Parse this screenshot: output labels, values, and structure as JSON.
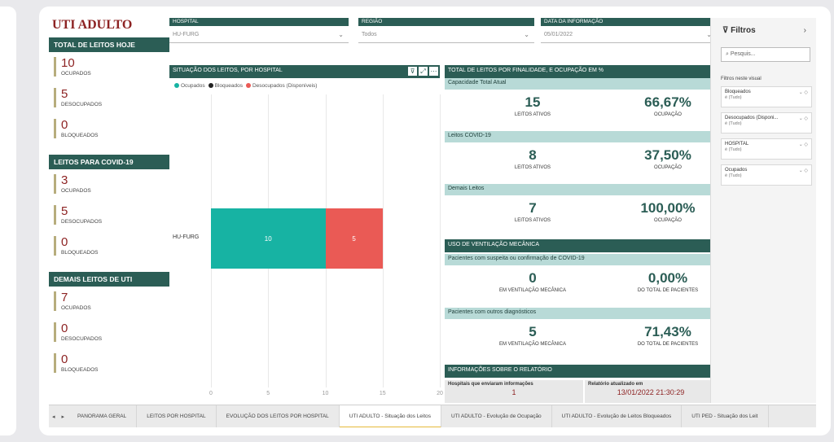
{
  "report": {
    "title": "UTI ADULTO",
    "sections": [
      {
        "header": "TOTAL DE LEITOS HOJE",
        "kpis": [
          {
            "value": "10",
            "label": "OCUPADOS"
          },
          {
            "value": "5",
            "label": "DESOCUPADOS"
          },
          {
            "value": "0",
            "label": "BLOQUEADOS"
          }
        ]
      },
      {
        "header": "LEITOS PARA COVID-19",
        "kpis": [
          {
            "value": "3",
            "label": "OCUPADOS"
          },
          {
            "value": "5",
            "label": "DESOCUPADOS"
          },
          {
            "value": "0",
            "label": "BLOQUEADOS"
          }
        ]
      },
      {
        "header": "DEMAIS LEITOS DE UTI",
        "kpis": [
          {
            "value": "7",
            "label": "OCUPADOS"
          },
          {
            "value": "0",
            "label": "DESOCUPADOS"
          },
          {
            "value": "0",
            "label": "BLOQUEADOS"
          }
        ]
      }
    ],
    "slicers": [
      {
        "label": "HOSPITAL",
        "value": "HU-FURG"
      },
      {
        "label": "REGIÃO",
        "value": "Todos"
      },
      {
        "label": "DATA DA INFORMAÇÃO",
        "value": "05/01/2022"
      }
    ],
    "chart_title": "SITUAÇÃO DOS LEITOS, POR HOSPITAL",
    "chart_icons": [
      "filter-icon",
      "focus-mode-icon",
      "more-options-icon"
    ],
    "right": {
      "header": "TOTAL DE LEITOS POR FINALIDADE, E OCUPAÇÃO EM %",
      "groups": [
        {
          "sub": "Capacidade Total Atual",
          "a_value": "15",
          "a_label": "LEITOS ATIVOS",
          "b_value": "66,67%",
          "b_label": "OCUPAÇÃO"
        },
        {
          "sub": "Leitos COVID-19",
          "a_value": "8",
          "a_label": "LEITOS ATIVOS",
          "b_value": "37,50%",
          "b_label": "OCUPAÇÃO"
        },
        {
          "sub": "Demais Leitos",
          "a_value": "7",
          "a_label": "LEITOS ATIVOS",
          "b_value": "100,00%",
          "b_label": "OCUPAÇÃO"
        }
      ],
      "vent_header": "USO DE VENTILAÇÃO MECÂNICA",
      "vent_groups": [
        {
          "sub": "Pacientes com suspeita ou confirmação de COVID-19",
          "a_value": "0",
          "a_label": "EM VENTILAÇÃO MECÂNICA",
          "b_value": "0,00%",
          "b_label": "DO TOTAL DE PACIENTES"
        },
        {
          "sub": "Pacientes com outros diagnósticos",
          "a_value": "5",
          "a_label": "EM VENTILAÇÃO MECÂNICA",
          "b_value": "71,43%",
          "b_label": "DO TOTAL DE PACIENTES"
        }
      ],
      "info_header": "INFORMAÇÕES SOBRE O RELATÓRIO",
      "info_hosp_label": "Hospitais que enviaram informações",
      "info_hosp_value": "1",
      "info_updated_label": "Relatório atualizado em",
      "info_updated_value": "13/01/2022 21:30:29"
    }
  },
  "filters": {
    "title": "Filtros",
    "search_placeholder": "Pesquis...",
    "section": "Filtros neste visual",
    "cards": [
      {
        "name": "Bloqueados",
        "state": "é (Tudo)"
      },
      {
        "name": "Desocupados (Disponi...",
        "state": "é (Tudo)"
      },
      {
        "name": "HOSPITAL",
        "state": "é (Tudo)"
      },
      {
        "name": "Ocupados",
        "state": "é (Tudo)"
      }
    ]
  },
  "tabs": [
    {
      "label": "PANORAMA GERAL",
      "active": false
    },
    {
      "label": "LEITOS POR HOSPITAL",
      "active": false
    },
    {
      "label": "EVOLUÇÃO DOS LEITOS POR HOSPITAL",
      "active": false
    },
    {
      "label": "UTI ADULTO - Situação dos Leitos",
      "active": true
    },
    {
      "label": "UTI ADULTO - Evolução de Ocupação",
      "active": false
    },
    {
      "label": "UTI ADULTO - Evolução de Leitos Bloqueados",
      "active": false
    },
    {
      "label": "UTI PED - Situação dos Leit",
      "active": false
    }
  ],
  "chart_data": {
    "type": "bar",
    "orientation": "horizontal",
    "stacked": true,
    "categories": [
      "HU-FURG"
    ],
    "series": [
      {
        "name": "Ocupados",
        "values": [
          10
        ],
        "color": "#17b3a3"
      },
      {
        "name": "Bloqueados",
        "values": [
          0
        ],
        "color": "#222222"
      },
      {
        "name": "Desocupados (Disponíveis)",
        "values": [
          5
        ],
        "color": "#ea5a55"
      }
    ],
    "xlim": [
      0,
      20
    ],
    "xticks": [
      0,
      5,
      10,
      15,
      20
    ],
    "grid": true,
    "legend": "top-left"
  }
}
